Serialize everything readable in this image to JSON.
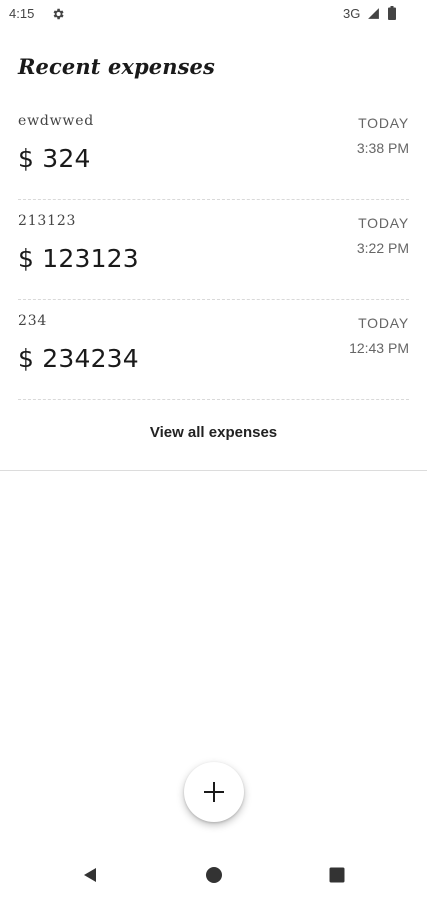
{
  "status_bar": {
    "time": "4:15",
    "network": "3G",
    "icons": [
      "gear-icon",
      "signal-icon",
      "battery-icon"
    ]
  },
  "section_title": "Recent expenses",
  "expenses": [
    {
      "name": "ewdwwed",
      "amount": "$ 324",
      "day": "TODAY",
      "time": "3:38 PM"
    },
    {
      "name": "213123",
      "amount": "$ 123123",
      "day": "TODAY",
      "time": "3:22 PM"
    },
    {
      "name": "234",
      "amount": "$ 234234",
      "day": "TODAY",
      "time": "12:43 PM"
    }
  ],
  "view_all_label": "View all expenses",
  "fab": {
    "icon": "plus-icon"
  },
  "nav_bar": {
    "icons": [
      "back-icon",
      "home-icon",
      "recents-icon"
    ]
  },
  "colors": {
    "text": "#1a1a1a",
    "muted": "#666666",
    "divider": "#dcdcdc",
    "background": "#ffffff"
  }
}
